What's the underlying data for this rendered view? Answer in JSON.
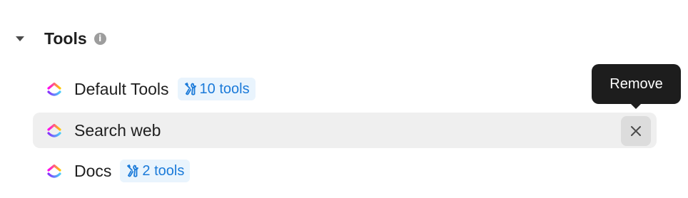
{
  "section": {
    "title": "Tools",
    "info_glyph": "i"
  },
  "tools": [
    {
      "label": "Default Tools",
      "badge": "10 tools",
      "icon": "clickup-logo"
    },
    {
      "label": "Search web",
      "icon": "clickup-logo",
      "action_icon": "close-icon"
    },
    {
      "label": "Docs",
      "badge": "2 tools",
      "icon": "clickup-logo"
    }
  ],
  "tooltip": {
    "text": "Remove"
  },
  "colors": {
    "badge_bg": "#e9f4fd",
    "badge_text": "#1a7ad9",
    "row_highlight": "#efefef",
    "tooltip_bg": "#1d1d1d"
  }
}
